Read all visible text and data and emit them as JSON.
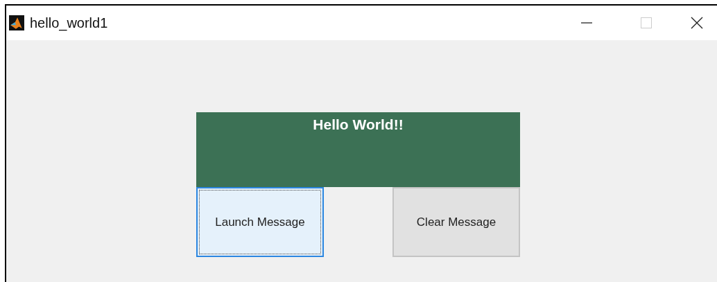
{
  "window": {
    "title": "hello_world1"
  },
  "panel": {
    "text": "Hello World!!"
  },
  "buttons": [
    {
      "label": "Launch Message",
      "focused": true
    },
    {
      "label": "Clear Message",
      "focused": false
    }
  ]
}
